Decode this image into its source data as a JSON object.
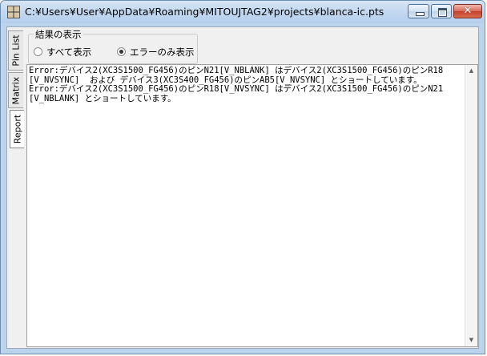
{
  "window": {
    "title": "C:¥Users¥User¥AppData¥Roaming¥MITOUJTAG2¥projects¥blanca-ic.pts",
    "controls": {
      "minimize": "",
      "maximize": "",
      "close": "✕"
    }
  },
  "tabs": [
    {
      "label": "Pin List",
      "active": false
    },
    {
      "label": "Matrix",
      "active": false
    },
    {
      "label": "Report",
      "active": true
    }
  ],
  "display_group": {
    "label": "結果の表示",
    "options": [
      {
        "label": "すべて表示",
        "selected": false
      },
      {
        "label": "エラーのみ表示",
        "selected": true
      }
    ]
  },
  "report": {
    "text": "Error:デバイス2(XC3S1500_FG456)のピンN21[V_NBLANK] はデバイス2(XC3S1500_FG456)のピンR18\n[V_NVSYNC]  および デバイス3(XC3S400_FG456)のピンAB5[V_NVSYNC] とショートしています。\nError:デバイス2(XC3S1500_FG456)のピンR18[V_NVSYNC] はデバイス2(XC3S1500_FG456)のピンN21\n[V_NBLANK] とショートしています。"
  },
  "scrollbar": {
    "up_glyph": "▲",
    "down_glyph": "▼"
  }
}
